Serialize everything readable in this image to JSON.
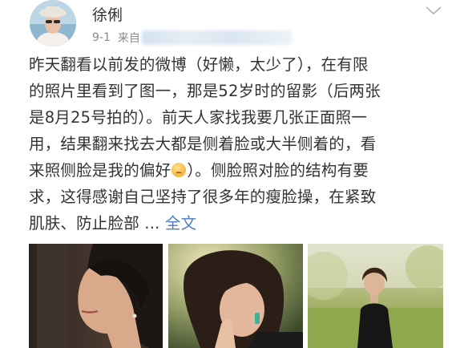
{
  "user": {
    "name": "徐俐",
    "date": "9-1",
    "source_prefix": "来自"
  },
  "post": {
    "lines": [
      "昨天翻看以前发的微博（好懒，太少了），在有限",
      "的照片里看到了图一，那是52岁时的留影（后两张",
      "是8月25号拍的）。前天人家找我要几张正面照一",
      "用，结果翻来找去大都是侧着脸或大半侧着的，看"
    ],
    "line5_before_emoji": "来照侧脸是我的偏好",
    "line5_after_emoji": "）。侧脸照对脸的结构有要",
    "line6": "求，这得感谢自己坚持了很多年的瘦脸操，在紧致",
    "line7_text": "肌肤、防止脸部 ... ",
    "full_text_link": "全文"
  },
  "icons": {
    "more": "chevron-down-icon",
    "emoji": "embarrassed-emoji-icon"
  },
  "colors": {
    "link": "#4a7bc4",
    "meta": "#8a8a8a",
    "text": "#333333"
  }
}
